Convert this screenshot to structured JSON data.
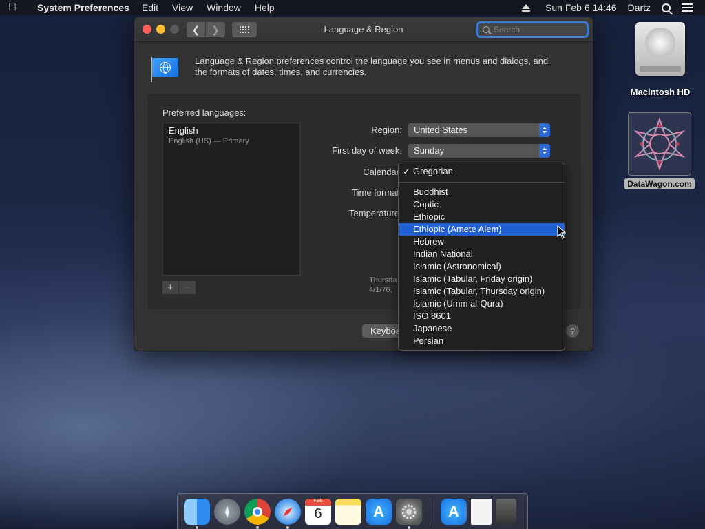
{
  "menubar": {
    "app_name": "System Preferences",
    "menus": [
      "Edit",
      "View",
      "Window",
      "Help"
    ],
    "clock": "Sun Feb 6  14:46",
    "user": "Dartz"
  },
  "window": {
    "title": "Language & Region",
    "search_placeholder": "Search",
    "intro": "Language & Region preferences control the language you see in menus and dialogs, and the formats of dates, times, and currencies.",
    "preferred_label": "Preferred languages:",
    "languages": [
      {
        "name": "English",
        "detail": "English (US) — Primary"
      }
    ],
    "add_label": "+",
    "remove_label": "−",
    "region_label": "Region:",
    "region_value": "United States",
    "first_day_label": "First day of week:",
    "first_day_value": "Sunday",
    "calendar_label": "Calendar",
    "time_format_label": "Time format",
    "temperature_label": "Temperature",
    "sample_line1": "Thursda",
    "sample_line2": "4/1/76,",
    "keyboard_button": "Keyboa",
    "help_button": "?"
  },
  "calendar_menu": {
    "checked": "Gregorian",
    "items": [
      "Buddhist",
      "Coptic",
      "Ethiopic",
      "Ethiopic (Amete Alem)",
      "Hebrew",
      "Indian National",
      "Islamic (Astronomical)",
      "Islamic (Tabular, Friday origin)",
      "Islamic (Tabular, Thursday origin)",
      "Islamic (Umm al-Qura)",
      "ISO 8601",
      "Japanese",
      "Persian"
    ],
    "highlighted": "Ethiopic (Amete Alem)"
  },
  "desktop": {
    "hd_label": "Macintosh HD",
    "datawagon_label": "DataWagon.com"
  },
  "dock": {
    "calendar_month": "FEB",
    "calendar_day": "6",
    "apps": [
      "finder-icon",
      "launchpad-icon",
      "chrome-icon",
      "safari-icon",
      "calendar-icon",
      "notes-icon",
      "app-store-icon",
      "system-preferences-icon",
      "app-store-icon",
      "document-icon",
      "trash-icon"
    ]
  },
  "colors": {
    "accent": "#1f5fd1",
    "close": "#fe5f57",
    "minimize": "#febc2e"
  }
}
